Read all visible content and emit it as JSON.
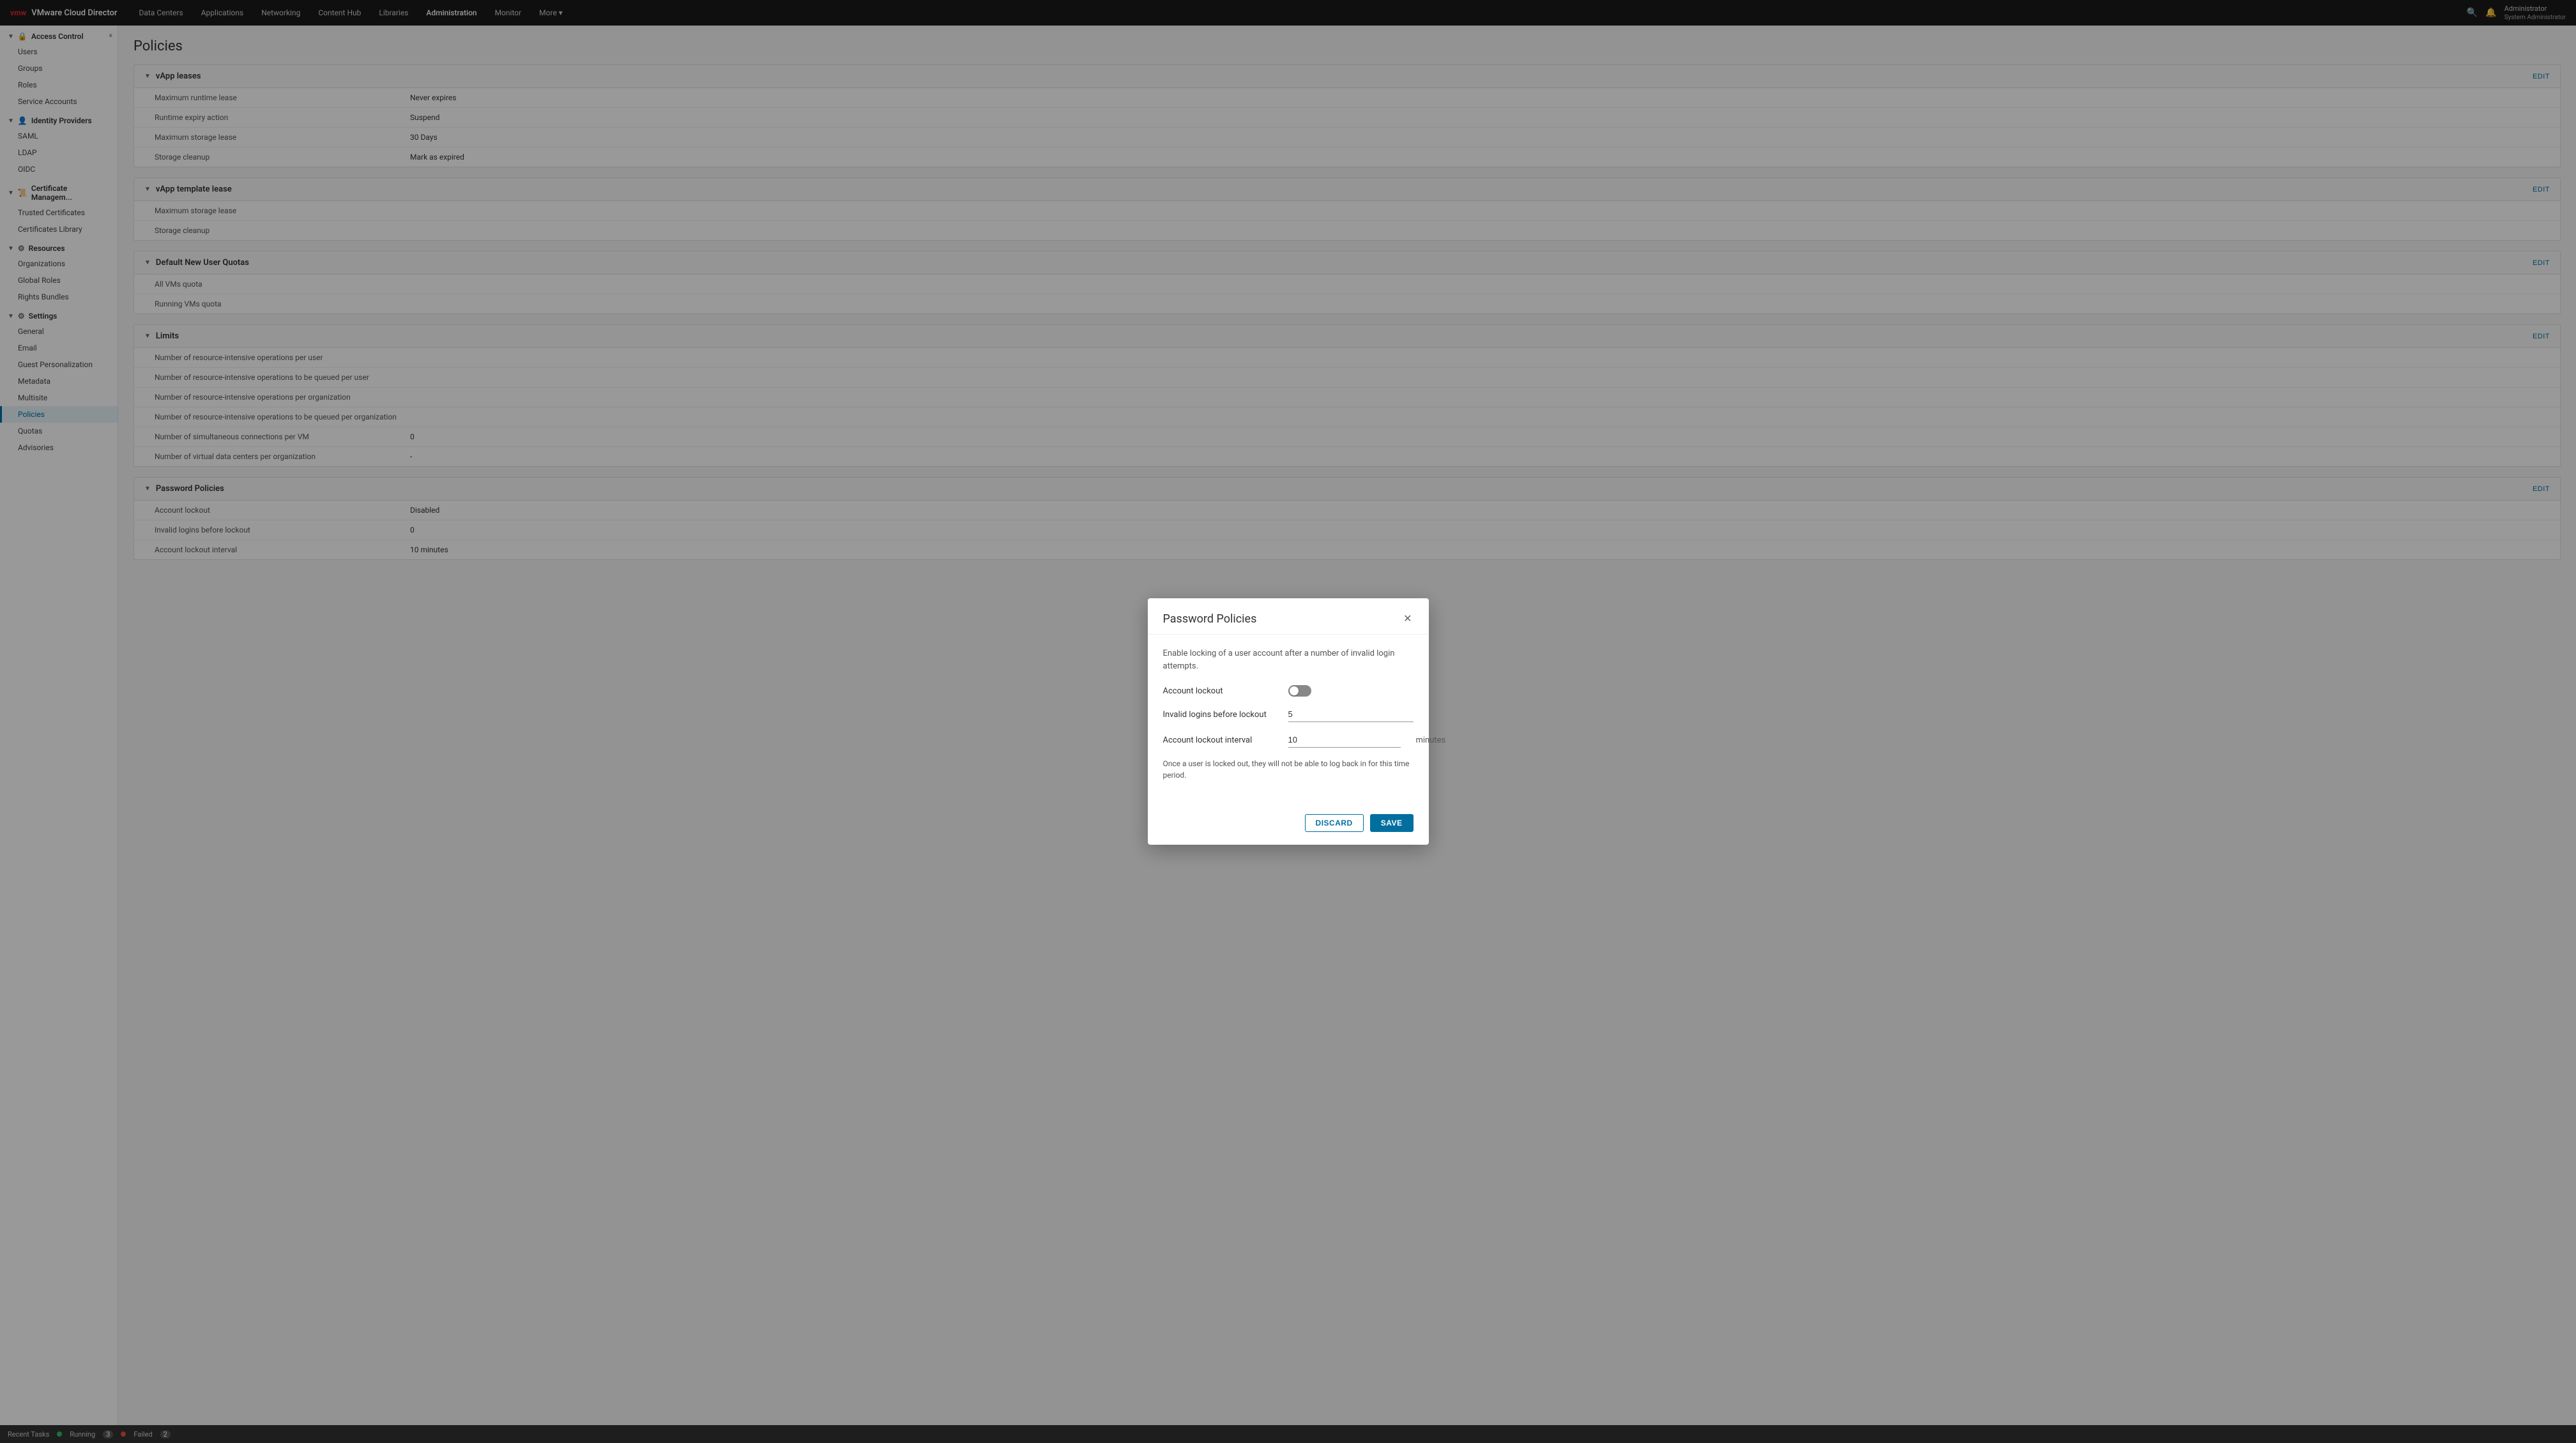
{
  "topNav": {
    "brand": "VMware Cloud Director",
    "vmwText": "vmw",
    "items": [
      {
        "label": "Data Centers",
        "active": false
      },
      {
        "label": "Applications",
        "active": false
      },
      {
        "label": "Networking",
        "active": false
      },
      {
        "label": "Content Hub",
        "active": false
      },
      {
        "label": "Libraries",
        "active": false
      },
      {
        "label": "Administration",
        "active": true
      },
      {
        "label": "Monitor",
        "active": false
      },
      {
        "label": "More ▾",
        "active": false
      }
    ],
    "userLabel": "Administrator\nSystem Administrator"
  },
  "sidebar": {
    "sections": [
      {
        "name": "Access Control",
        "items": [
          "Users",
          "Groups",
          "Roles",
          "Service Accounts"
        ]
      },
      {
        "name": "Identity Providers",
        "items": [
          "SAML",
          "LDAP",
          "OIDC"
        ]
      },
      {
        "name": "Certificate Managem...",
        "items": [
          "Trusted Certificates",
          "Certificates Library"
        ]
      },
      {
        "name": "Resources",
        "items": [
          "Organizations",
          "Global Roles",
          "Rights Bundles"
        ]
      },
      {
        "name": "Settings",
        "items": [
          "General",
          "Email",
          "Guest Personalization",
          "Metadata",
          "Multisite",
          "Policies",
          "Quotas",
          "Advisories"
        ]
      }
    ]
  },
  "page": {
    "title": "Policies"
  },
  "policySections": [
    {
      "title": "vApp leases",
      "rows": [
        {
          "label": "Maximum runtime lease",
          "value": "Never expires"
        },
        {
          "label": "Runtime expiry action",
          "value": "Suspend"
        },
        {
          "label": "Maximum storage lease",
          "value": "30 Days"
        },
        {
          "label": "Storage cleanup",
          "value": "Mark as expired"
        }
      ]
    },
    {
      "title": "vApp template lease",
      "rows": [
        {
          "label": "Maximum storage lease",
          "value": ""
        },
        {
          "label": "Storage cleanup",
          "value": ""
        }
      ]
    },
    {
      "title": "Default New User Quotas",
      "rows": [
        {
          "label": "All VMs quota",
          "value": ""
        },
        {
          "label": "Running VMs quota",
          "value": ""
        }
      ]
    },
    {
      "title": "Limits",
      "rows": [
        {
          "label": "Number of resource-intensive operations per user",
          "value": ""
        },
        {
          "label": "Number of resource-intensive operations to be queued per user",
          "value": ""
        },
        {
          "label": "Number of resource-intensive operations per organization",
          "value": ""
        },
        {
          "label": "Number of resource-intensive operations to be queued per organization",
          "value": ""
        },
        {
          "label": "Number of simultaneous connections per VM",
          "value": "0"
        },
        {
          "label": "Number of virtual data centers per organization",
          "value": "-"
        }
      ]
    },
    {
      "title": "Password Policies",
      "rows": [
        {
          "label": "Account lockout",
          "value": "Disabled"
        },
        {
          "label": "Invalid logins before lockout",
          "value": "0"
        },
        {
          "label": "Account lockout interval",
          "value": "10 minutes"
        }
      ]
    }
  ],
  "modal": {
    "title": "Password Policies",
    "description": "Enable locking of a user account after a number of invalid login attempts.",
    "accountLockoutLabel": "Account lockout",
    "toggleState": "off",
    "invalidLoginsLabel": "Invalid logins before lockout",
    "invalidLoginsValue": "5",
    "lockoutIntervalLabel": "Account lockout interval",
    "lockoutIntervalValue": "10",
    "lockoutIntervalSuffix": "minutes",
    "note": "Once a user is locked out, they will not be able to log back in for this time period.",
    "discardLabel": "DISCARD",
    "saveLabel": "SAVE"
  },
  "statusBar": {
    "label": "Recent Tasks",
    "running": "Running",
    "runningCount": "3",
    "failed": "Failed",
    "failedCount": "2"
  }
}
